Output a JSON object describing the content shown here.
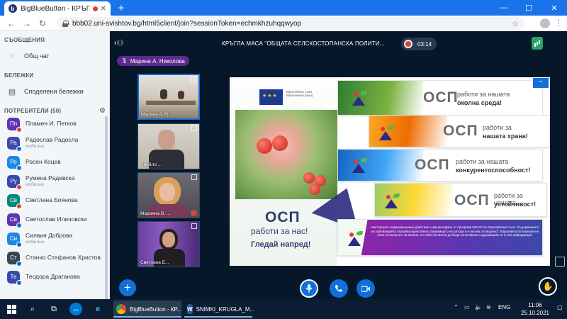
{
  "browser": {
    "tab_title": "BigBlueButton - КРЪГЛА МА",
    "tab_favicon": "b",
    "url": "bbb02.uni-svishtov.bg/html5client/join?sessionToken=echmkhzuhqqwyop",
    "back_icon": "←",
    "forward_icon": "→",
    "reload_icon": "↻",
    "new_tab": "+",
    "minimize": "—",
    "maximize": "☐",
    "close": "✕"
  },
  "sidebar": {
    "messages_title": "СЪОБЩЕНИЯ",
    "public_chat": "Общ чат",
    "notes_title": "БЕЛЕЖКИ",
    "shared_notes": "Споделени бележки",
    "users_title": "ПОТРЕБИТЕЛИ (50)",
    "users": [
      {
        "initials": "Пп",
        "name": "Пламен И. Петков",
        "role": "",
        "color": "#5e35b1",
        "dot": "red"
      },
      {
        "initials": "Ра",
        "name": "Радослав Радосла",
        "role": "мобилно",
        "color": "#3949ab",
        "dot": "blue"
      },
      {
        "initials": "Ро",
        "name": "Росен Коцев",
        "role": "",
        "color": "#1e88e5",
        "dot": "blue"
      },
      {
        "initials": "Ру",
        "name": "Румена Радевска",
        "role": "мобилно",
        "color": "#3949ab",
        "dot": "red"
      },
      {
        "initials": "Св",
        "name": "Светлана Боянова",
        "role": "",
        "color": "#00897b",
        "dot": "red"
      },
      {
        "initials": "Св",
        "name": "Светослав Иличовски",
        "role": "",
        "color": "#5e35b1",
        "dot": "blue"
      },
      {
        "initials": "Си",
        "name": "Силвия Доброва",
        "role": "мобилно",
        "color": "#1e88e5",
        "dot": "blue"
      },
      {
        "initials": "Ст",
        "name": "Станчо Стефанов Христов",
        "role": "",
        "color": "#37474f",
        "dot": "blue"
      },
      {
        "initials": "Те",
        "name": "Теодора Драганова",
        "role": "",
        "color": "#3949ab",
        "dot": "blue"
      }
    ]
  },
  "main": {
    "meeting_title": "КРЪГЛА МАСА \"ОБЩАТА СЕЛСКОСТОПАНСКА ПОЛИТИ...",
    "recording_time": "03:14",
    "talking_user": "Марина А. Николова",
    "videos": [
      {
        "name": "Марина А. Н...",
        "active": true
      },
      {
        "name": "Инейло ...",
        "active": false
      },
      {
        "name": "Марияна В. ...",
        "active": false
      },
      {
        "name": "Светлана Б...",
        "active": false
      }
    ],
    "slide": {
      "eu_text": "Европейски съюз · Европейски фонд",
      "osp": "ОСП",
      "tagline1": "работи за нас!",
      "tagline2": "Гледай напред!",
      "bands": [
        {
          "osp": "ОСП",
          "line1": "работи за нашата",
          "line2": "околна среда!"
        },
        {
          "osp": "ОСП",
          "line1": "работи за",
          "line2": "нашата храна!"
        },
        {
          "osp": "ОСП",
          "line1": "работи за нашата",
          "line2": "конкурентоспособност!"
        },
        {
          "osp": "ОСП",
          "line1": "работи за нашата",
          "line2": "устойчивост!"
        }
      ],
      "fine_print": "Настоящото информационно действие е финансирано от програма IMCAP на Европейския съюз. Съдържанието на публикацията отразява единствено становището на автора и е негова отговорност. Европейската Комисия не носи отговорност за начина, по който би могла да бъде използвана съдържащата се в нея информация."
    },
    "add_action": "+",
    "minimize_slide": "−"
  },
  "taskbar": {
    "chrome_app": "BigBlueButton - КР...",
    "word_app": "SNIMKI_KRUGLA_M...",
    "lang": "ENG",
    "time": "11:06",
    "date": "25.10.2021"
  },
  "colors": {
    "brand_blue": "#0f70d7",
    "dark_bg": "#06172a",
    "chrome_blue": "#1a73e8"
  }
}
